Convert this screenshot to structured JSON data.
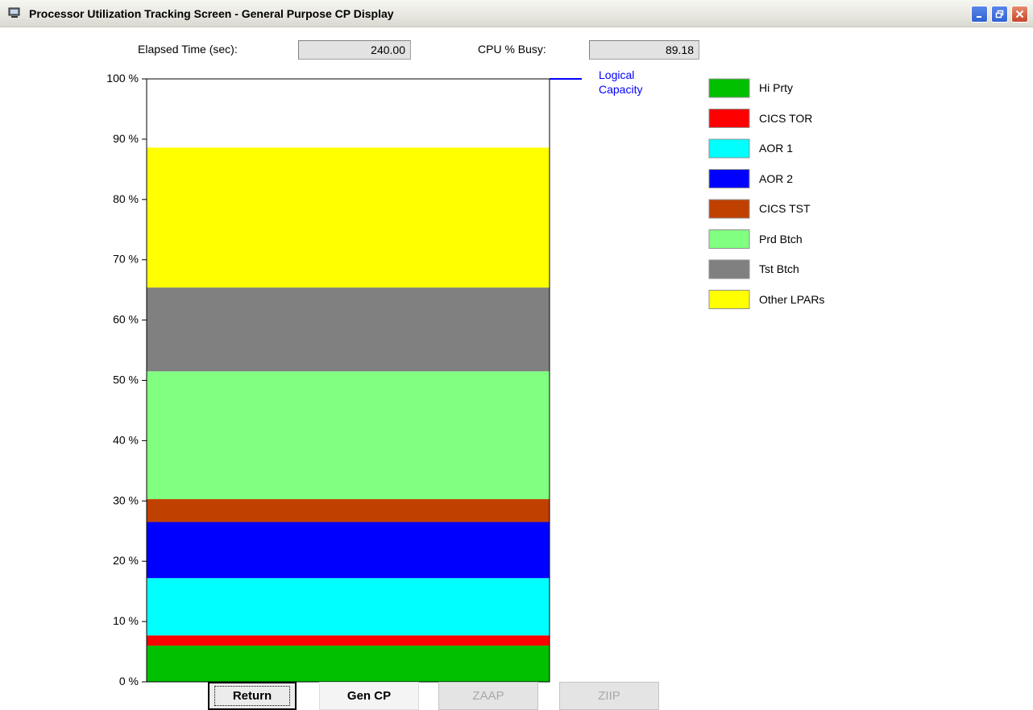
{
  "window": {
    "title": "Processor Utilization Tracking Screen - General Purpose CP Display"
  },
  "stats": {
    "elapsed_label": "Elapsed Time (sec):",
    "elapsed_value": "240.00",
    "cpu_label": "CPU % Busy:",
    "cpu_value": "89.18"
  },
  "chart_data": {
    "type": "bar",
    "stacked": true,
    "ylim": [
      0,
      100
    ],
    "yticks": [
      "0 %",
      "10 %",
      "20 %",
      "30 %",
      "40 %",
      "50 %",
      "60 %",
      "70 %",
      "80 %",
      "90 %",
      "100 %"
    ],
    "series": [
      {
        "name": "Hi Prty",
        "color": "#00c000",
        "value": 6.0
      },
      {
        "name": "CICS TOR",
        "color": "#ff0000",
        "value": 1.7
      },
      {
        "name": "AOR 1",
        "color": "#00ffff",
        "value": 9.5
      },
      {
        "name": "AOR 2",
        "color": "#0000ff",
        "value": 9.3
      },
      {
        "name": "CICS TST",
        "color": "#c04000",
        "value": 3.8
      },
      {
        "name": "Prd Btch",
        "color": "#80ff80",
        "value": 21.2
      },
      {
        "name": "Tst Btch",
        "color": "#808080",
        "value": 13.9
      },
      {
        "name": "Other LPARs",
        "color": "#ffff00",
        "value": 23.2
      }
    ],
    "capacity_line": {
      "label_line1": "Logical",
      "label_line2": "Capacity",
      "value": 100,
      "color": "#0000ff"
    }
  },
  "buttons": {
    "return": "Return",
    "gen_cp": "Gen CP",
    "zaap": "ZAAP",
    "ziip": "ZIIP"
  }
}
